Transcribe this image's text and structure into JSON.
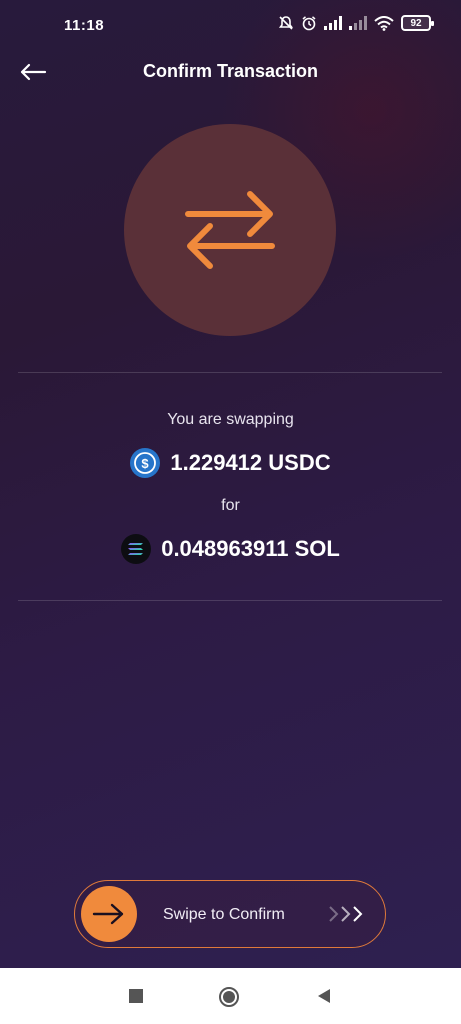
{
  "status_bar": {
    "time": "11:18",
    "battery": "92",
    "icons": [
      "mute-icon",
      "alarm-icon",
      "signal-icon",
      "signal-weak-icon",
      "wifi-icon",
      "battery-icon"
    ]
  },
  "header": {
    "title": "Confirm Transaction",
    "back_icon": "arrow-left-icon"
  },
  "hero": {
    "icon": "swap-arrows-icon",
    "accent_color": "#f08a3c",
    "circle_color": "#5a3038"
  },
  "swap": {
    "label": "You are swapping",
    "from_amount": "1.229412 USDC",
    "from_icon": "usdc-icon",
    "for_label": "for",
    "to_amount": "0.048963911 SOL",
    "to_icon": "solana-icon"
  },
  "swipe": {
    "label": "Swipe to Confirm",
    "handle_icon": "arrow-right-icon",
    "chevrons_icon": "triple-chevron-right-icon"
  },
  "nav_bar": {
    "buttons": [
      "recent-apps-icon",
      "home-icon",
      "back-triangle-icon"
    ]
  }
}
